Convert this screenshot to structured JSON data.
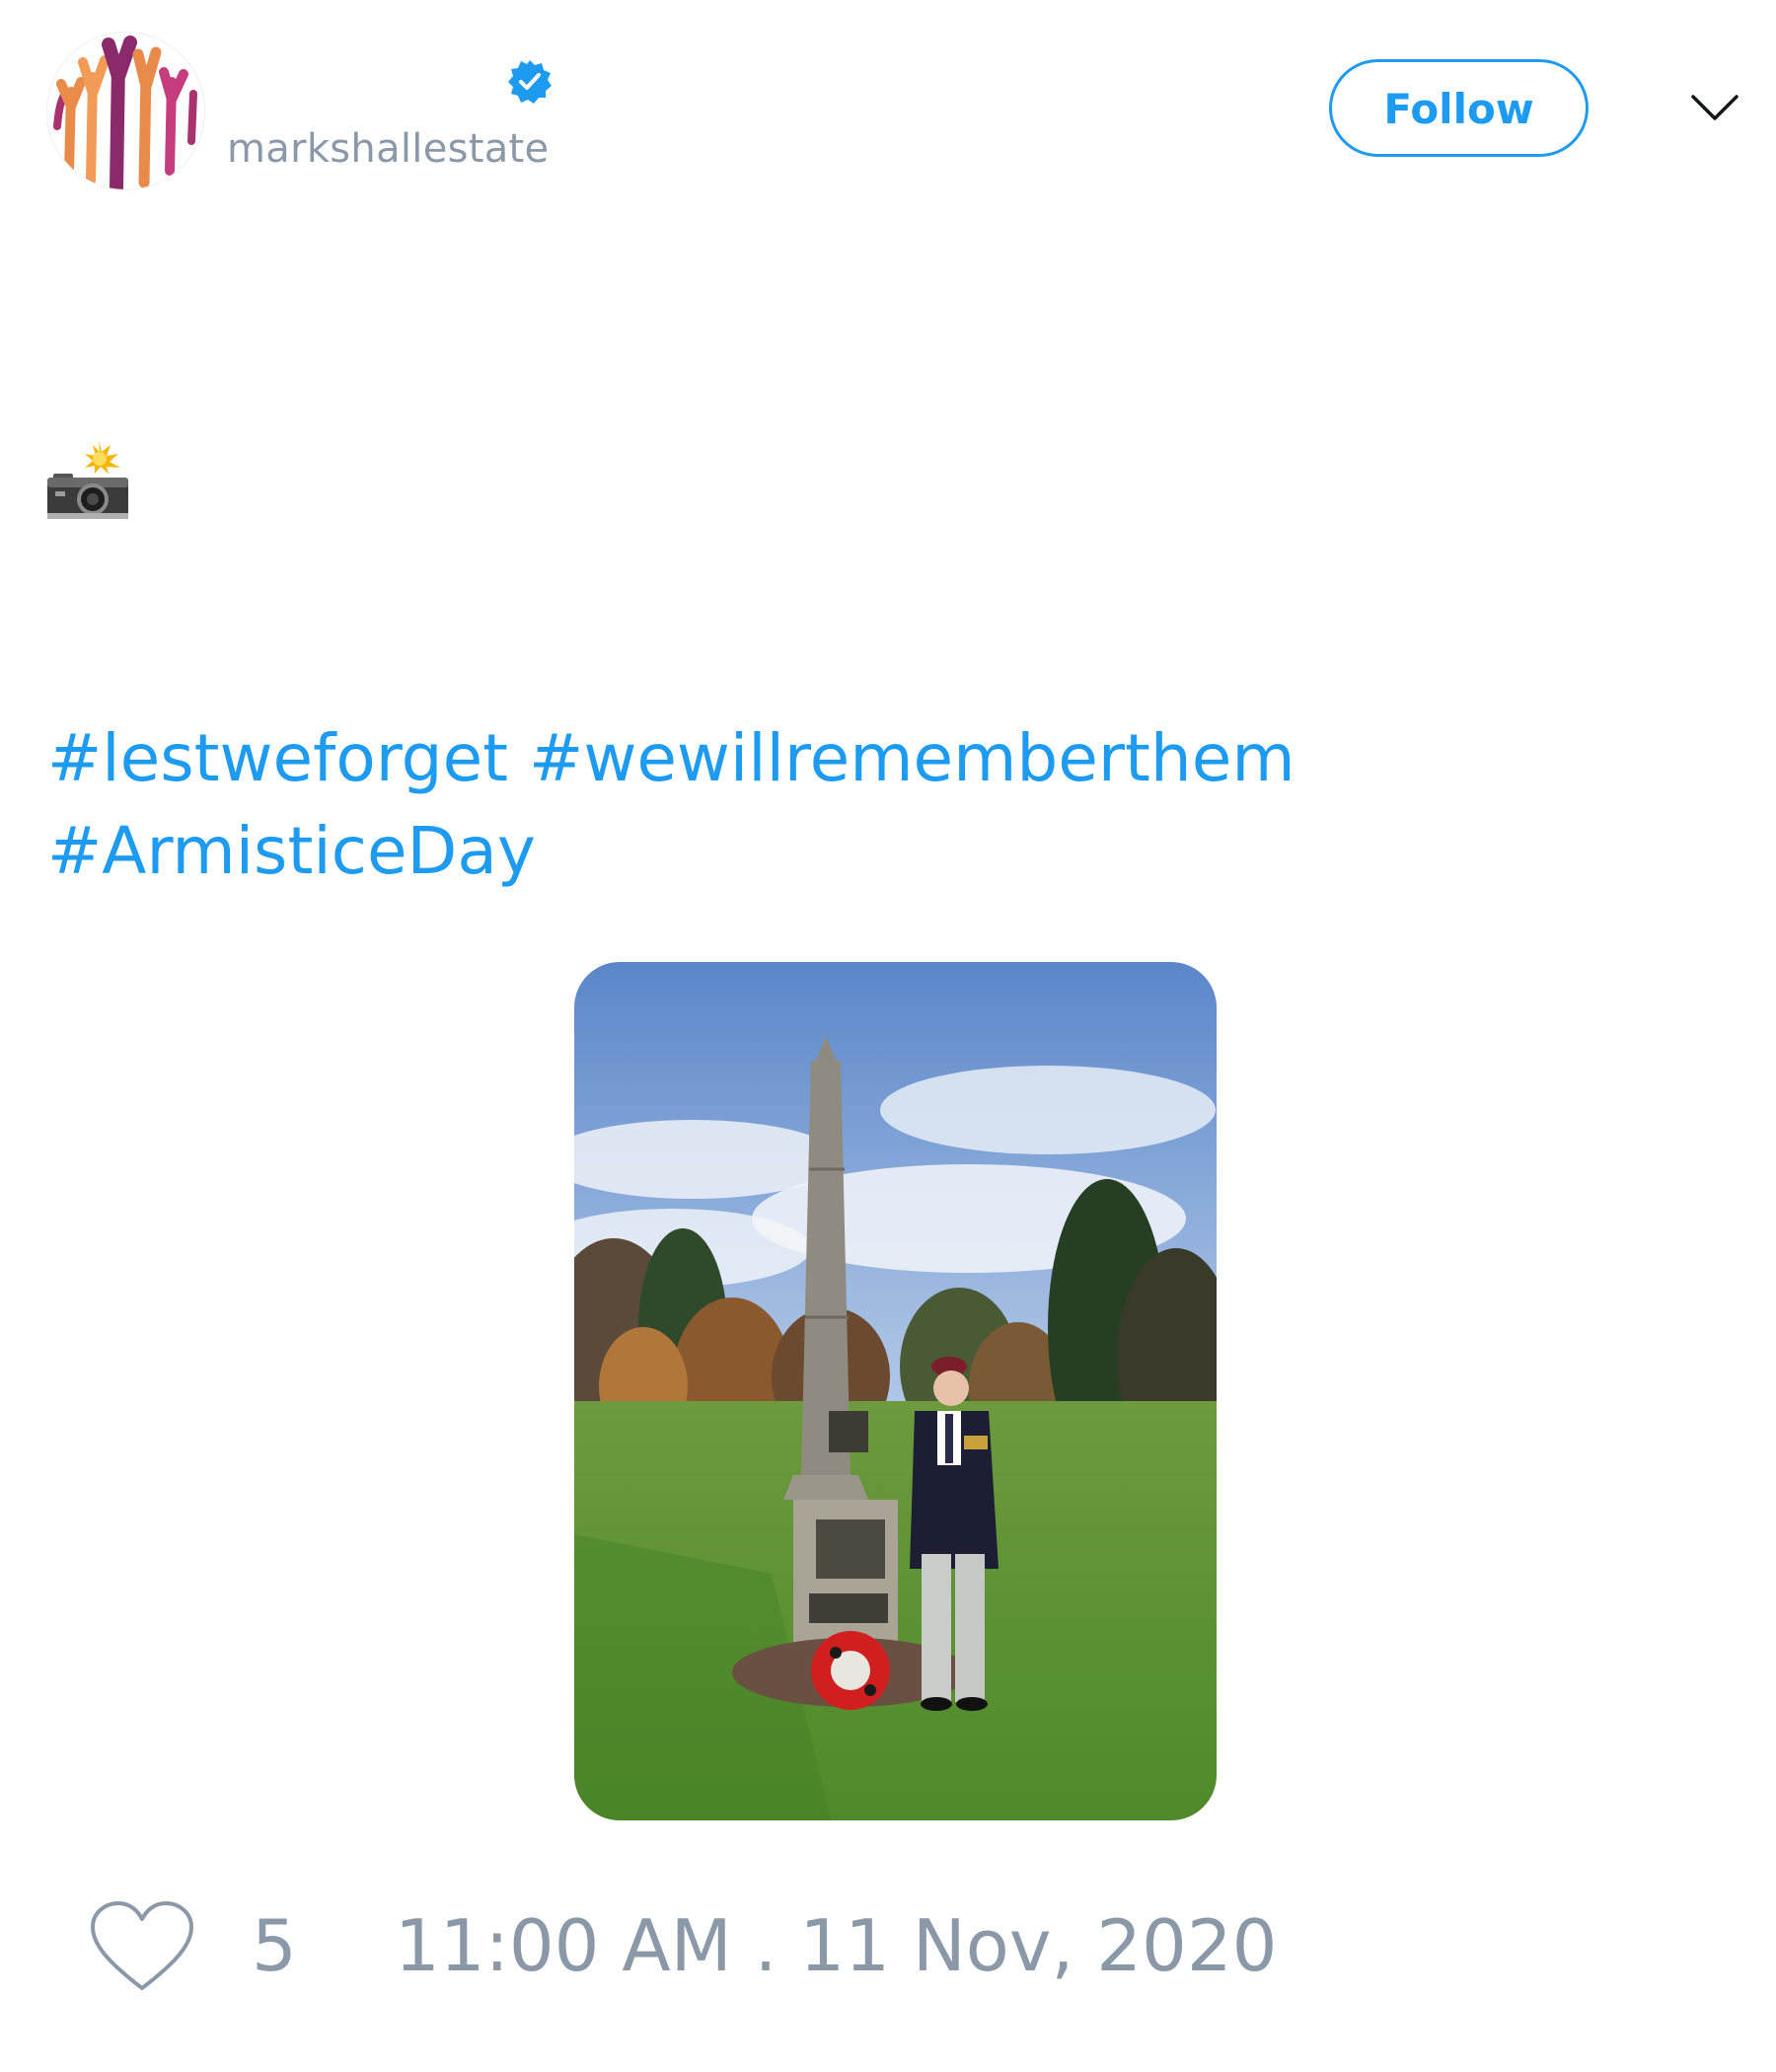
{
  "header": {
    "display_name": "",
    "handle": "markshallestate",
    "verified": true,
    "follow_label": "Follow",
    "more_menu_icon": "chevron-down-icon"
  },
  "tweet": {
    "emoji": "📸",
    "hashtags": [
      "#lestweforget",
      "#wewillrememberthem",
      "#ArmisticeDay"
    ],
    "photo_icon": "photo"
  },
  "footer": {
    "like_icon": "heart-outline-icon",
    "like_count": "5",
    "timestamp": "11:00 AM . 11 Nov, 2020"
  },
  "colors": {
    "accent": "#1d9bf0",
    "muted": "#8b98a8",
    "background": "#ffffff"
  }
}
